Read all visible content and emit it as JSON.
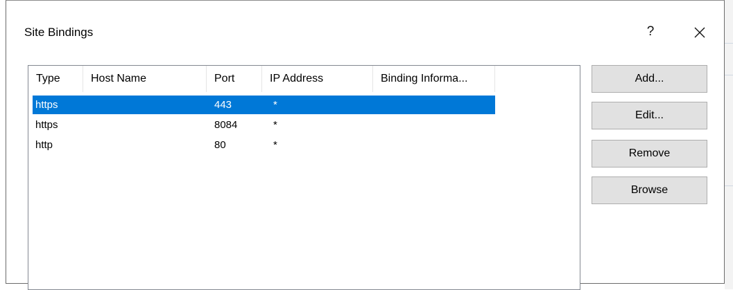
{
  "dialog": {
    "title": "Site Bindings",
    "help_label": "?"
  },
  "table": {
    "columns": [
      "Type",
      "Host Name",
      "Port",
      "IP Address",
      "Binding Informa..."
    ],
    "rows": [
      {
        "type": "https",
        "host": "",
        "port": "443",
        "ip": "*",
        "info": "",
        "selected": true
      },
      {
        "type": "https",
        "host": "",
        "port": "8084",
        "ip": "*",
        "info": "",
        "selected": false
      },
      {
        "type": "http",
        "host": "",
        "port": "80",
        "ip": "*",
        "info": "",
        "selected": false
      }
    ]
  },
  "buttons": {
    "add": "Add...",
    "edit": "Edit...",
    "remove": "Remove",
    "browse": "Browse"
  },
  "colors": {
    "selection": "#0078d7",
    "button_face": "#e1e1e1"
  }
}
